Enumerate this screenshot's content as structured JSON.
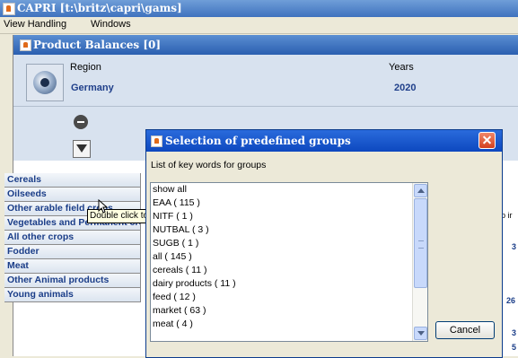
{
  "app": {
    "title": "CAPRI [t:\\britz\\capri\\gams]"
  },
  "menubar": {
    "items": [
      "View Handling",
      "Windows"
    ]
  },
  "inner_window": {
    "title": "Product Balances [0]",
    "region_label": "Region",
    "region_value": "Germany",
    "years_label": "Years",
    "years_value": "2020"
  },
  "groups": [
    "Cereals",
    "Oilseeds",
    "Other arable field crops",
    "Vegetables and Permanent crops",
    "All other crops",
    "Fodder",
    "Meat",
    "Other Animal products",
    "Young animals"
  ],
  "side_numbers": [
    "3",
    "26",
    "3",
    "5"
  ],
  "side_clip_text": "p ir",
  "tooltip": "Double click to",
  "dialog": {
    "title": "Selection of predefined groups",
    "caption": "List of key words for groups",
    "items": [
      "show all",
      "EAA  ( 115 )",
      "NITF  ( 1 )",
      "NUTBAL  ( 3 )",
      "SUGB  ( 1 )",
      "all  ( 145 )",
      "cereals  ( 11 )",
      "dairy products  ( 11 )",
      "feed  ( 12 )",
      "market  ( 63 )",
      "meat  ( 4 )"
    ],
    "cancel_label": "Cancel"
  },
  "colors": {
    "titlebar_blue": "#0d48bf",
    "group_text": "#1a3d88",
    "close_red": "#d3401f"
  }
}
